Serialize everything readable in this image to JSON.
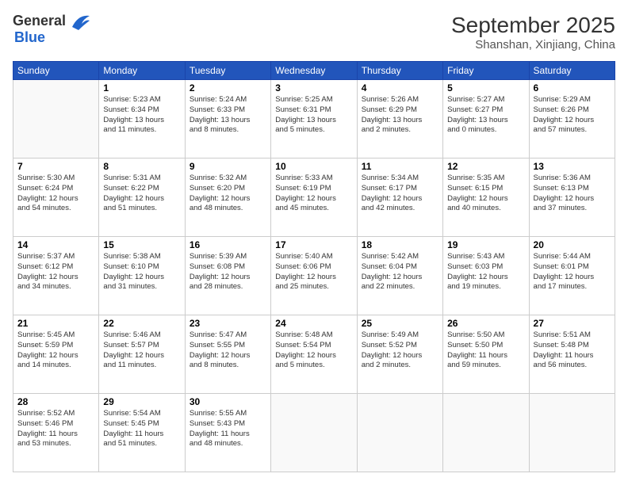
{
  "header": {
    "logo_general": "General",
    "logo_blue": "Blue",
    "month": "September 2025",
    "location": "Shanshan, Xinjiang, China"
  },
  "weekdays": [
    "Sunday",
    "Monday",
    "Tuesday",
    "Wednesday",
    "Thursday",
    "Friday",
    "Saturday"
  ],
  "weeks": [
    [
      {
        "day": "",
        "info": ""
      },
      {
        "day": "1",
        "info": "Sunrise: 5:23 AM\nSunset: 6:34 PM\nDaylight: 13 hours\nand 11 minutes."
      },
      {
        "day": "2",
        "info": "Sunrise: 5:24 AM\nSunset: 6:33 PM\nDaylight: 13 hours\nand 8 minutes."
      },
      {
        "day": "3",
        "info": "Sunrise: 5:25 AM\nSunset: 6:31 PM\nDaylight: 13 hours\nand 5 minutes."
      },
      {
        "day": "4",
        "info": "Sunrise: 5:26 AM\nSunset: 6:29 PM\nDaylight: 13 hours\nand 2 minutes."
      },
      {
        "day": "5",
        "info": "Sunrise: 5:27 AM\nSunset: 6:27 PM\nDaylight: 13 hours\nand 0 minutes."
      },
      {
        "day": "6",
        "info": "Sunrise: 5:29 AM\nSunset: 6:26 PM\nDaylight: 12 hours\nand 57 minutes."
      }
    ],
    [
      {
        "day": "7",
        "info": "Sunrise: 5:30 AM\nSunset: 6:24 PM\nDaylight: 12 hours\nand 54 minutes."
      },
      {
        "day": "8",
        "info": "Sunrise: 5:31 AM\nSunset: 6:22 PM\nDaylight: 12 hours\nand 51 minutes."
      },
      {
        "day": "9",
        "info": "Sunrise: 5:32 AM\nSunset: 6:20 PM\nDaylight: 12 hours\nand 48 minutes."
      },
      {
        "day": "10",
        "info": "Sunrise: 5:33 AM\nSunset: 6:19 PM\nDaylight: 12 hours\nand 45 minutes."
      },
      {
        "day": "11",
        "info": "Sunrise: 5:34 AM\nSunset: 6:17 PM\nDaylight: 12 hours\nand 42 minutes."
      },
      {
        "day": "12",
        "info": "Sunrise: 5:35 AM\nSunset: 6:15 PM\nDaylight: 12 hours\nand 40 minutes."
      },
      {
        "day": "13",
        "info": "Sunrise: 5:36 AM\nSunset: 6:13 PM\nDaylight: 12 hours\nand 37 minutes."
      }
    ],
    [
      {
        "day": "14",
        "info": "Sunrise: 5:37 AM\nSunset: 6:12 PM\nDaylight: 12 hours\nand 34 minutes."
      },
      {
        "day": "15",
        "info": "Sunrise: 5:38 AM\nSunset: 6:10 PM\nDaylight: 12 hours\nand 31 minutes."
      },
      {
        "day": "16",
        "info": "Sunrise: 5:39 AM\nSunset: 6:08 PM\nDaylight: 12 hours\nand 28 minutes."
      },
      {
        "day": "17",
        "info": "Sunrise: 5:40 AM\nSunset: 6:06 PM\nDaylight: 12 hours\nand 25 minutes."
      },
      {
        "day": "18",
        "info": "Sunrise: 5:42 AM\nSunset: 6:04 PM\nDaylight: 12 hours\nand 22 minutes."
      },
      {
        "day": "19",
        "info": "Sunrise: 5:43 AM\nSunset: 6:03 PM\nDaylight: 12 hours\nand 19 minutes."
      },
      {
        "day": "20",
        "info": "Sunrise: 5:44 AM\nSunset: 6:01 PM\nDaylight: 12 hours\nand 17 minutes."
      }
    ],
    [
      {
        "day": "21",
        "info": "Sunrise: 5:45 AM\nSunset: 5:59 PM\nDaylight: 12 hours\nand 14 minutes."
      },
      {
        "day": "22",
        "info": "Sunrise: 5:46 AM\nSunset: 5:57 PM\nDaylight: 12 hours\nand 11 minutes."
      },
      {
        "day": "23",
        "info": "Sunrise: 5:47 AM\nSunset: 5:55 PM\nDaylight: 12 hours\nand 8 minutes."
      },
      {
        "day": "24",
        "info": "Sunrise: 5:48 AM\nSunset: 5:54 PM\nDaylight: 12 hours\nand 5 minutes."
      },
      {
        "day": "25",
        "info": "Sunrise: 5:49 AM\nSunset: 5:52 PM\nDaylight: 12 hours\nand 2 minutes."
      },
      {
        "day": "26",
        "info": "Sunrise: 5:50 AM\nSunset: 5:50 PM\nDaylight: 11 hours\nand 59 minutes."
      },
      {
        "day": "27",
        "info": "Sunrise: 5:51 AM\nSunset: 5:48 PM\nDaylight: 11 hours\nand 56 minutes."
      }
    ],
    [
      {
        "day": "28",
        "info": "Sunrise: 5:52 AM\nSunset: 5:46 PM\nDaylight: 11 hours\nand 53 minutes."
      },
      {
        "day": "29",
        "info": "Sunrise: 5:54 AM\nSunset: 5:45 PM\nDaylight: 11 hours\nand 51 minutes."
      },
      {
        "day": "30",
        "info": "Sunrise: 5:55 AM\nSunset: 5:43 PM\nDaylight: 11 hours\nand 48 minutes."
      },
      {
        "day": "",
        "info": ""
      },
      {
        "day": "",
        "info": ""
      },
      {
        "day": "",
        "info": ""
      },
      {
        "day": "",
        "info": ""
      }
    ]
  ]
}
